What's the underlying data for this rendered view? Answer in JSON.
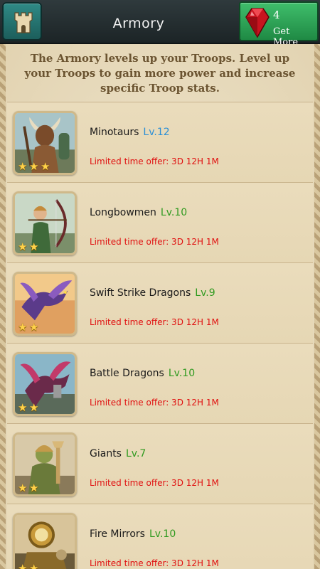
{
  "header": {
    "title": "Armory",
    "home_icon": "castle-tower-icon",
    "gems": {
      "count": "4",
      "label": "Get More",
      "icon": "red-gem-icon"
    }
  },
  "intro": "The Armory levels up your Troops.  Level up your Troops to gain more power and increase specific Troop stats.",
  "troops": [
    {
      "name": "Minotaurs",
      "level": "Lv.12",
      "level_color": "#2a8fd6",
      "offer": "Limited time offer: 3D 12H 1M",
      "stars": 3,
      "art": "minotaur"
    },
    {
      "name": "Longbowmen",
      "level": "Lv.10",
      "level_color": "#2f9a1f",
      "offer": "Limited time offer: 3D 12H 1M",
      "stars": 2,
      "art": "archer"
    },
    {
      "name": "Swift Strike Dragons",
      "level": "Lv.9",
      "level_color": "#2f9a1f",
      "offer": "Limited time offer: 3D 12H 1M",
      "stars": 2,
      "art": "dragon-purple"
    },
    {
      "name": "Battle Dragons",
      "level": "Lv.10",
      "level_color": "#2f9a1f",
      "offer": "Limited time offer: 3D 12H 1M",
      "stars": 2,
      "art": "dragon-armored"
    },
    {
      "name": "Giants",
      "level": "Lv.7",
      "level_color": "#2f9a1f",
      "offer": "Limited time offer: 3D 12H 1M",
      "stars": 2,
      "art": "giant"
    },
    {
      "name": "Fire Mirrors",
      "level": "Lv.10",
      "level_color": "#2f9a1f",
      "offer": "Limited time offer: 3D 12H 1M",
      "stars": 2,
      "art": "fire-mirror"
    }
  ]
}
